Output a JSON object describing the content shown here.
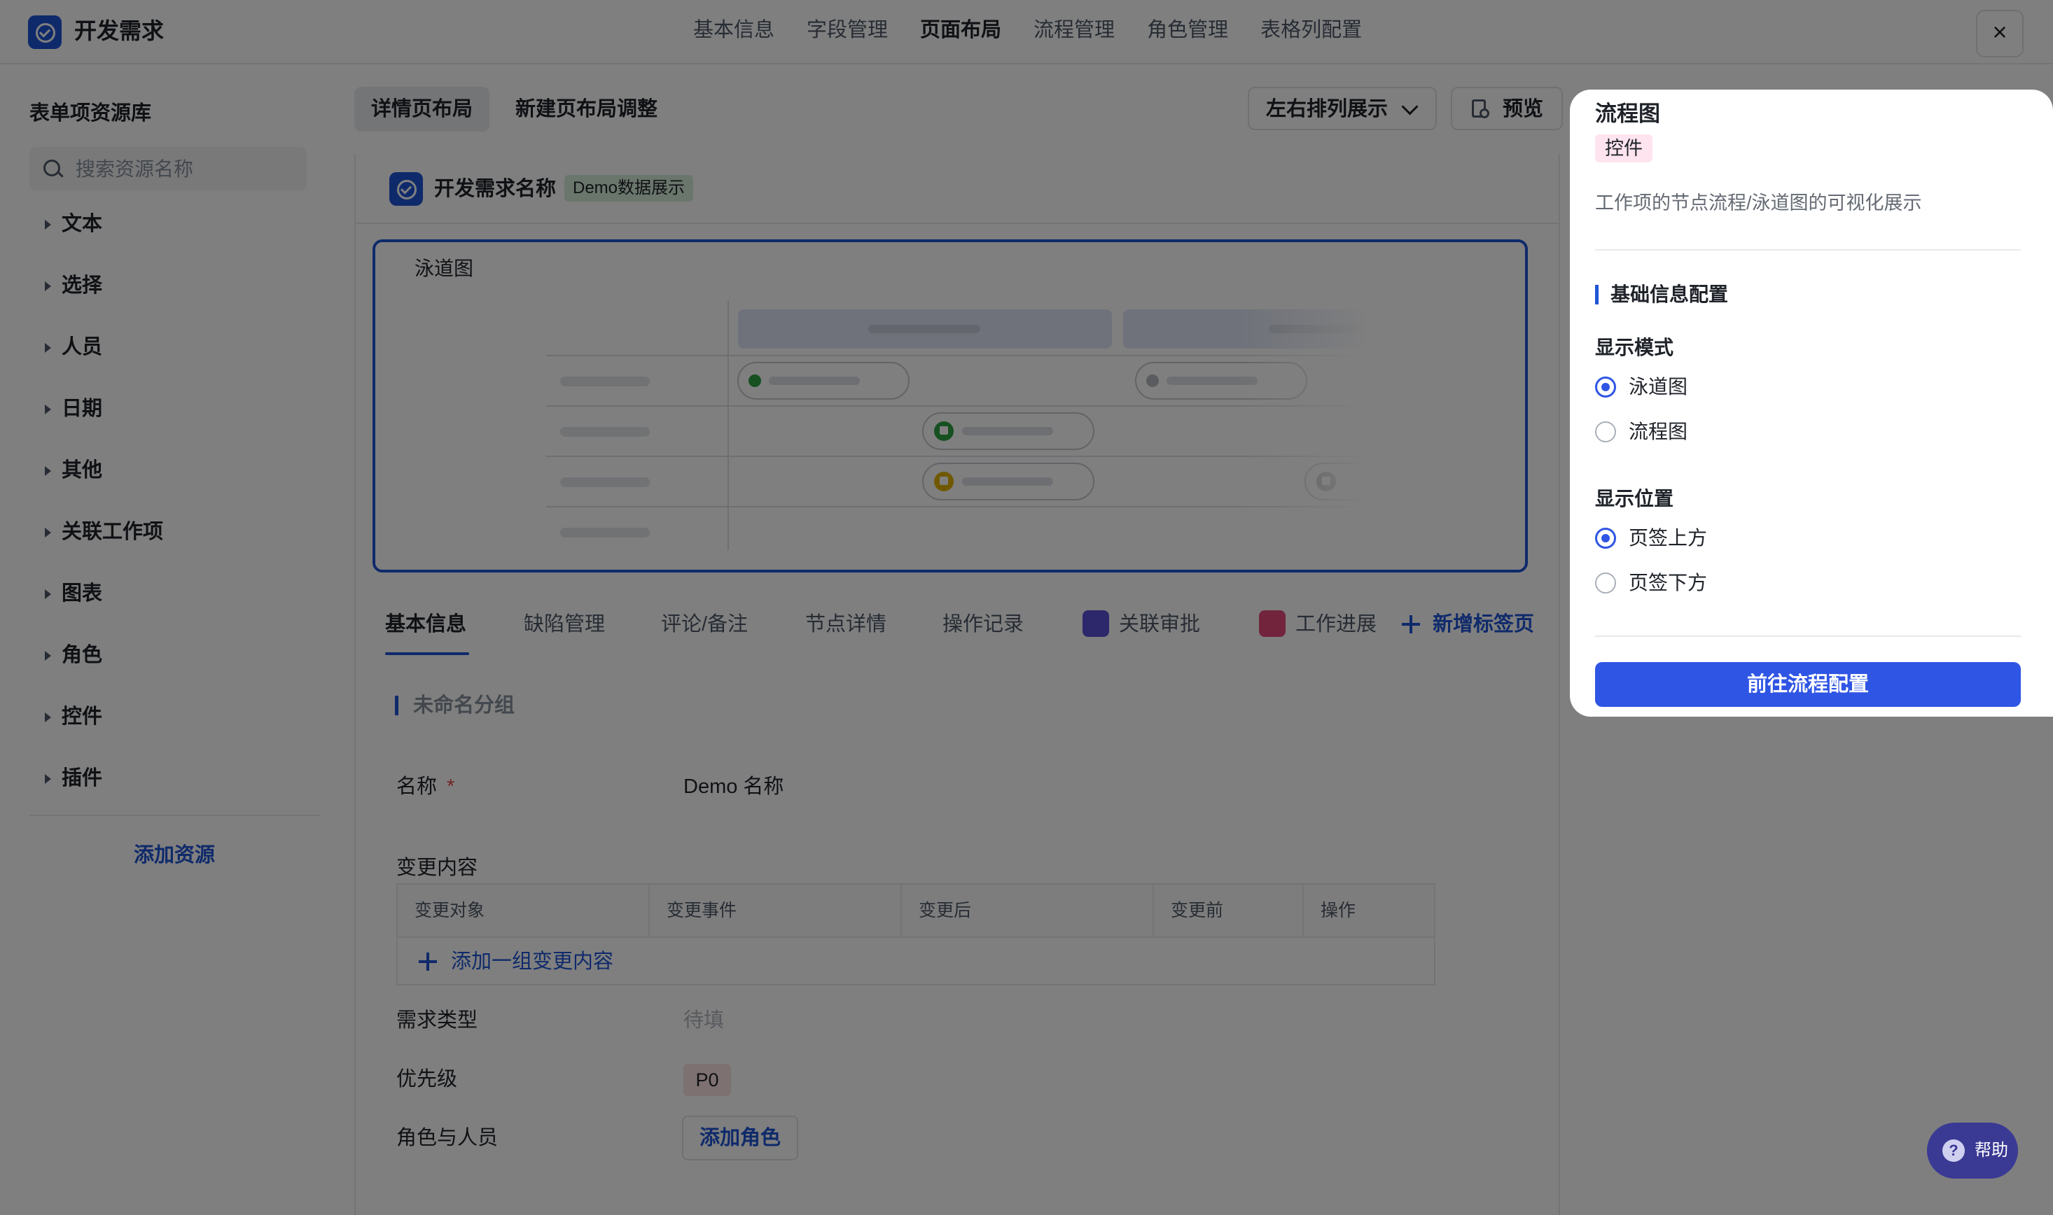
{
  "app": {
    "title": "开发需求",
    "nav_tabs": [
      "基本信息",
      "字段管理",
      "页面布局",
      "流程管理",
      "角色管理",
      "表格列配置"
    ],
    "active_nav": "页面布局",
    "close_symbol": "×"
  },
  "sidebar": {
    "title": "表单项资源库",
    "search_placeholder": "搜索资源名称",
    "items": [
      "文本",
      "选择",
      "人员",
      "日期",
      "其他",
      "关联工作项",
      "图表",
      "角色",
      "控件",
      "插件"
    ],
    "add_resource": "添加资源"
  },
  "toolbar": {
    "layout_tabs": [
      "详情页布局",
      "新建页布局调整"
    ],
    "display_mode": "左右排列展示",
    "preview": "预览"
  },
  "demo": {
    "name": "开发需求名称",
    "badge": "Demo数据展示",
    "swimlane_title": "泳道图",
    "page_tabs": [
      "基本信息",
      "缺陷管理",
      "评论/备注",
      "节点详情",
      "操作记录",
      "关联审批",
      "工作进展"
    ],
    "add_tab": "新增标签页",
    "group_title": "未命名分组",
    "fields": {
      "name_label": "名称",
      "required_mark": "*",
      "name_value": "Demo 名称",
      "change_label": "变更内容",
      "change_columns": [
        "变更对象",
        "变更事件",
        "变更后",
        "变更前",
        "操作"
      ],
      "change_add": "添加一组变更内容",
      "type_label": "需求类型",
      "type_value": "待填",
      "priority_label": "优先级",
      "priority_value": "P0",
      "role_label": "角色与人员",
      "role_button": "添加角色"
    }
  },
  "panel": {
    "title": "流程图",
    "tag": "控件",
    "description": "工作项的节点流程/泳道图的可视化展示",
    "section_title": "基础信息配置",
    "display_mode_label": "显示模式",
    "display_mode_options": [
      {
        "label": "泳道图",
        "selected": true
      },
      {
        "label": "流程图",
        "selected": false
      }
    ],
    "position_label": "显示位置",
    "position_options": [
      {
        "label": "页签上方",
        "selected": true
      },
      {
        "label": "页签下方",
        "selected": false
      }
    ],
    "go_button": "前往流程配置"
  },
  "help": {
    "label": "帮助",
    "icon": "?"
  },
  "colors": {
    "accent": "#2f55e4",
    "brand": "#1f55d6",
    "overlay": "rgba(0,0,0,0.5)"
  }
}
